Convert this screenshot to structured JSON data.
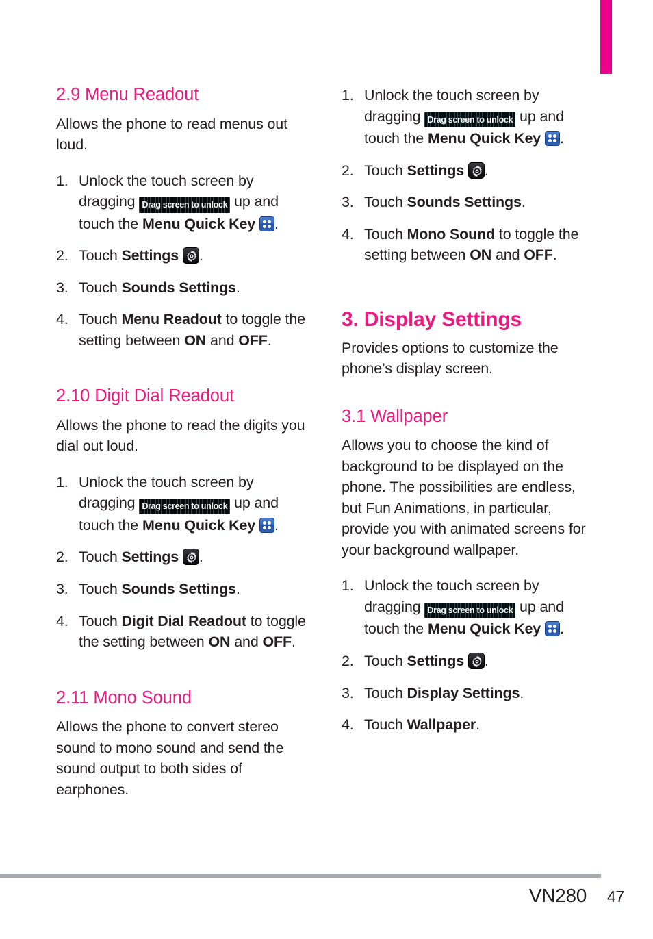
{
  "page": {
    "model": "VN280",
    "page_number": "47",
    "accent_color": "#ec1a7f",
    "tab_color": "#ec008c",
    "rule_color": "#a7a9ac"
  },
  "icons": {
    "unlock_badge_label": "Drag screen to unlock",
    "quick_key_name": "menu-quick-key-icon",
    "settings_gear_name": "settings-gear-icon"
  },
  "left_column": {
    "section_29": {
      "heading": "2.9 Menu Readout",
      "intro": "Allows the phone to read menus out loud.",
      "steps": [
        {
          "num": "1.",
          "parts": [
            {
              "t": "text",
              "v": "Unlock the touch screen by dragging "
            },
            {
              "t": "badge",
              "v": "Drag screen to unlock"
            },
            {
              "t": "text",
              "v": " up and touch the "
            },
            {
              "t": "bold",
              "v": "Menu Quick Key"
            },
            {
              "t": "text",
              "v": " "
            },
            {
              "t": "quickkey",
              "v": ""
            },
            {
              "t": "text",
              "v": "."
            }
          ]
        },
        {
          "num": "2.",
          "parts": [
            {
              "t": "text",
              "v": "Touch "
            },
            {
              "t": "bold",
              "v": "Settings"
            },
            {
              "t": "text",
              "v": " "
            },
            {
              "t": "gear",
              "v": ""
            },
            {
              "t": "text",
              "v": "."
            }
          ]
        },
        {
          "num": "3.",
          "parts": [
            {
              "t": "text",
              "v": "Touch "
            },
            {
              "t": "bold",
              "v": "Sounds Settings"
            },
            {
              "t": "text",
              "v": "."
            }
          ]
        },
        {
          "num": "4.",
          "parts": [
            {
              "t": "text",
              "v": "Touch "
            },
            {
              "t": "bold",
              "v": "Menu Readout"
            },
            {
              "t": "text",
              "v": " to toggle the setting between "
            },
            {
              "t": "bold",
              "v": "ON"
            },
            {
              "t": "text",
              "v": " and "
            },
            {
              "t": "bold",
              "v": "OFF"
            },
            {
              "t": "text",
              "v": "."
            }
          ]
        }
      ]
    },
    "section_210": {
      "heading": "2.10 Digit Dial Readout",
      "intro": "Allows the phone to read the digits you dial out loud.",
      "steps": [
        {
          "num": "1.",
          "parts": [
            {
              "t": "text",
              "v": "Unlock the touch screen by dragging "
            },
            {
              "t": "badge",
              "v": "Drag screen to unlock"
            },
            {
              "t": "text",
              "v": " up and touch the "
            },
            {
              "t": "bold",
              "v": "Menu Quick Key"
            },
            {
              "t": "text",
              "v": " "
            },
            {
              "t": "quickkey",
              "v": ""
            },
            {
              "t": "text",
              "v": "."
            }
          ]
        },
        {
          "num": "2.",
          "parts": [
            {
              "t": "text",
              "v": "Touch "
            },
            {
              "t": "bold",
              "v": "Settings"
            },
            {
              "t": "text",
              "v": " "
            },
            {
              "t": "gear",
              "v": ""
            },
            {
              "t": "text",
              "v": "."
            }
          ]
        },
        {
          "num": "3.",
          "parts": [
            {
              "t": "text",
              "v": "Touch "
            },
            {
              "t": "bold",
              "v": "Sounds Settings"
            },
            {
              "t": "text",
              "v": "."
            }
          ]
        },
        {
          "num": "4.",
          "parts": [
            {
              "t": "text",
              "v": "Touch "
            },
            {
              "t": "bold",
              "v": "Digit Dial Readout"
            },
            {
              "t": "text",
              "v": " to toggle the setting between "
            },
            {
              "t": "bold",
              "v": "ON"
            },
            {
              "t": "text",
              "v": " and "
            },
            {
              "t": "bold",
              "v": "OFF"
            },
            {
              "t": "text",
              "v": "."
            }
          ]
        }
      ]
    },
    "section_211": {
      "heading": "2.11 Mono Sound",
      "intro": "Allows the phone to convert stereo sound to mono sound and send the sound output to both sides of earphones."
    }
  },
  "right_column": {
    "mono_sound_steps": [
      {
        "num": "1.",
        "parts": [
          {
            "t": "text",
            "v": "Unlock the touch screen by dragging "
          },
          {
            "t": "badge",
            "v": "Drag screen to unlock"
          },
          {
            "t": "text",
            "v": " up and touch the "
          },
          {
            "t": "bold",
            "v": "Menu Quick Key"
          },
          {
            "t": "text",
            "v": " "
          },
          {
            "t": "quickkey",
            "v": ""
          },
          {
            "t": "text",
            "v": "."
          }
        ]
      },
      {
        "num": "2.",
        "parts": [
          {
            "t": "text",
            "v": "Touch "
          },
          {
            "t": "bold",
            "v": "Settings"
          },
          {
            "t": "text",
            "v": " "
          },
          {
            "t": "gear",
            "v": ""
          },
          {
            "t": "text",
            "v": "."
          }
        ]
      },
      {
        "num": "3.",
        "parts": [
          {
            "t": "text",
            "v": "Touch "
          },
          {
            "t": "bold",
            "v": "Sounds Settings"
          },
          {
            "t": "text",
            "v": "."
          }
        ]
      },
      {
        "num": "4.",
        "parts": [
          {
            "t": "text",
            "v": "Touch "
          },
          {
            "t": "bold",
            "v": "Mono Sound"
          },
          {
            "t": "text",
            "v": " to toggle the setting between "
          },
          {
            "t": "bold",
            "v": "ON"
          },
          {
            "t": "text",
            "v": " and "
          },
          {
            "t": "bold",
            "v": "OFF"
          },
          {
            "t": "text",
            "v": "."
          }
        ]
      }
    ],
    "section_3": {
      "heading": "3. Display Settings",
      "intro": "Provides options to customize the phone’s display screen."
    },
    "section_31": {
      "heading": "3.1 Wallpaper",
      "intro": "Allows you to choose the kind of background to be displayed on the phone. The possibilities are endless, but Fun Animations, in particular, provide you with animated screens for your background wallpaper.",
      "steps": [
        {
          "num": "1.",
          "parts": [
            {
              "t": "text",
              "v": "Unlock the touch screen by dragging "
            },
            {
              "t": "badge",
              "v": "Drag screen to unlock"
            },
            {
              "t": "text",
              "v": " up and touch the "
            },
            {
              "t": "bold",
              "v": "Menu Quick Key"
            },
            {
              "t": "text",
              "v": " "
            },
            {
              "t": "quickkey",
              "v": ""
            },
            {
              "t": "text",
              "v": "."
            }
          ]
        },
        {
          "num": "2.",
          "parts": [
            {
              "t": "text",
              "v": "Touch "
            },
            {
              "t": "bold",
              "v": "Settings"
            },
            {
              "t": "text",
              "v": " "
            },
            {
              "t": "gear",
              "v": ""
            },
            {
              "t": "text",
              "v": "."
            }
          ]
        },
        {
          "num": "3.",
          "parts": [
            {
              "t": "text",
              "v": "Touch "
            },
            {
              "t": "bold",
              "v": "Display Settings"
            },
            {
              "t": "text",
              "v": "."
            }
          ]
        },
        {
          "num": "4.",
          "parts": [
            {
              "t": "text",
              "v": "Touch "
            },
            {
              "t": "bold",
              "v": "Wallpaper"
            },
            {
              "t": "text",
              "v": "."
            }
          ]
        }
      ]
    }
  }
}
